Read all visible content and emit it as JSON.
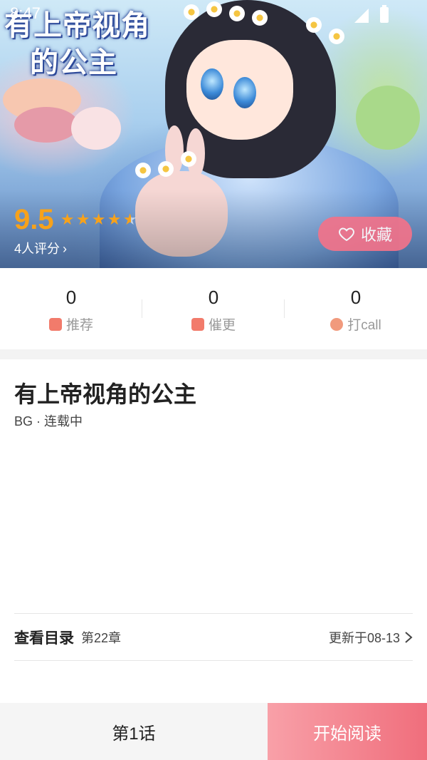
{
  "status_bar": {
    "time": "8:47"
  },
  "cover": {
    "title_line1": "有上帝视角",
    "title_line2": "的公主"
  },
  "rating": {
    "score": "9.5",
    "stars": 4.5,
    "count_text": "4人评分",
    "star_color": "#f7a21b"
  },
  "favorite": {
    "label": "收藏",
    "icon": "heart-outline-icon"
  },
  "stats": [
    {
      "value": "0",
      "label": "推荐",
      "icon": "recommend-icon"
    },
    {
      "value": "0",
      "label": "催更",
      "icon": "urge-update-icon"
    },
    {
      "value": "0",
      "label": "打call",
      "icon": "call-icon"
    }
  ],
  "info": {
    "title": "有上帝视角的公主",
    "meta": "BG · 连载中"
  },
  "toc": {
    "label": "查看目录",
    "chapter": "第22章",
    "updated": "更新于08-13"
  },
  "bottom": {
    "episode_label": "第1话",
    "read_label": "开始阅读"
  },
  "colors": {
    "accent": "#f06e7c",
    "favorite_bg": "#f2738a",
    "rating": "#f7a21b"
  }
}
